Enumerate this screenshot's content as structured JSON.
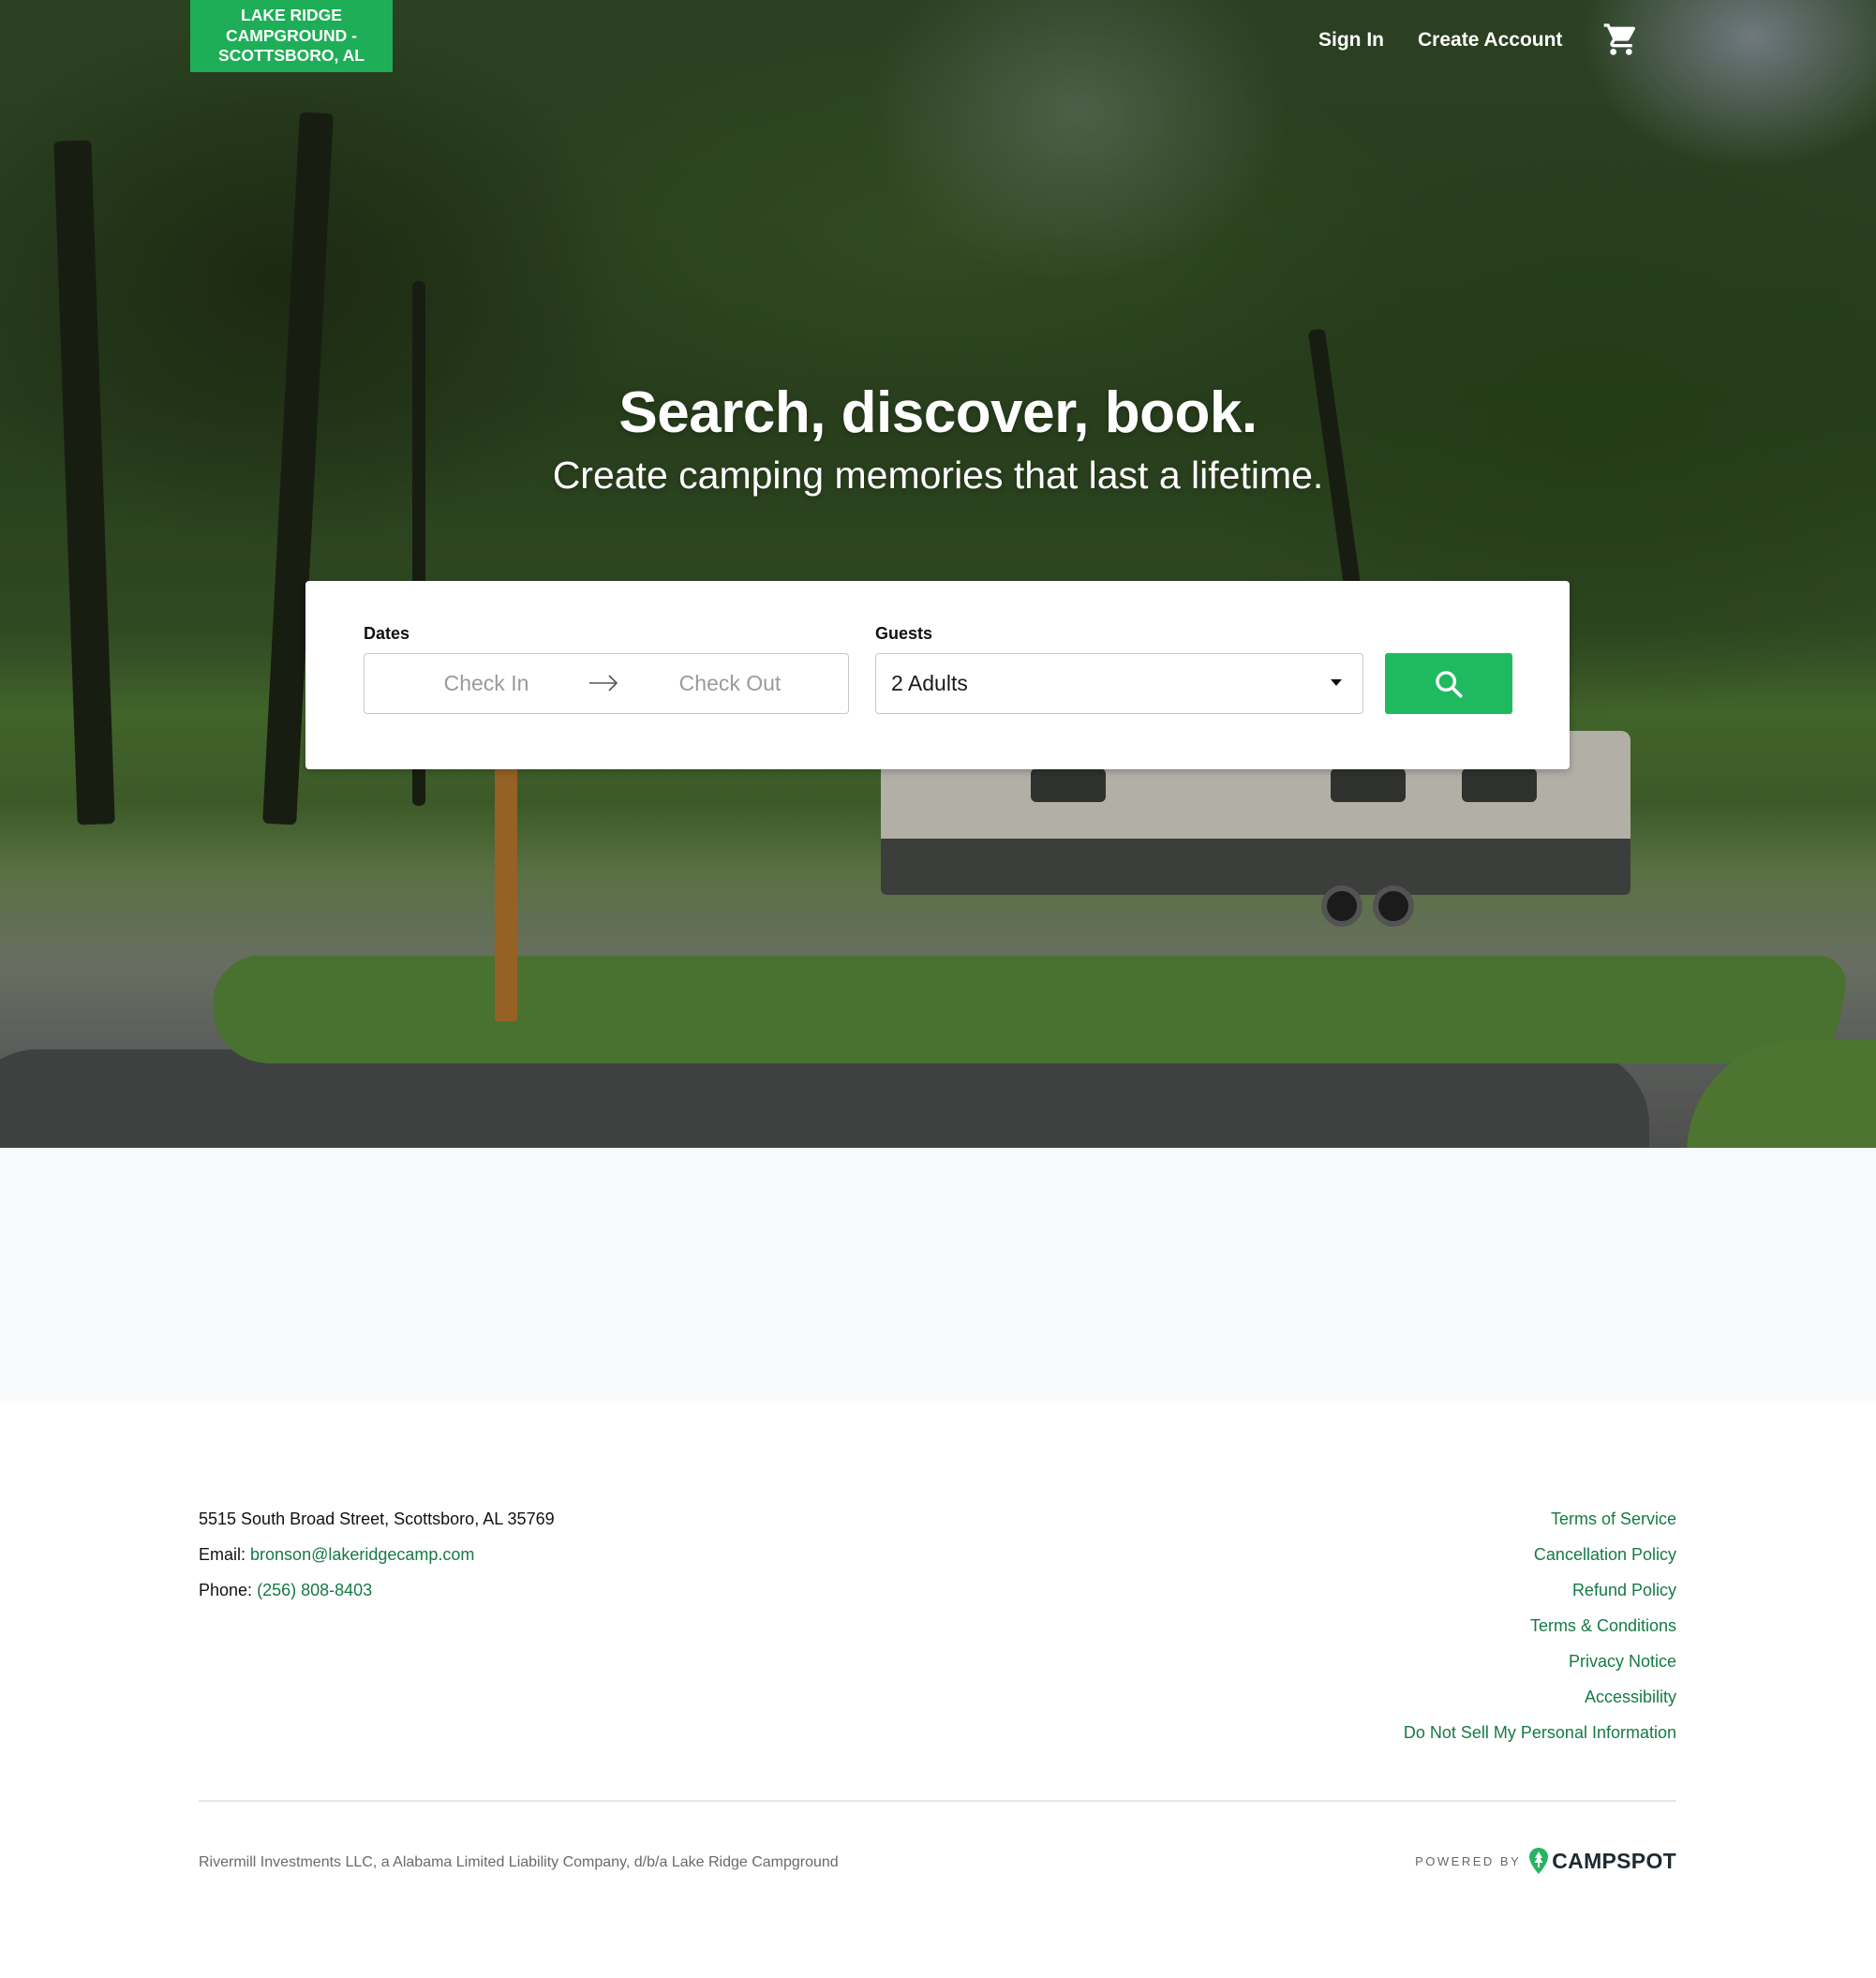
{
  "header": {
    "logo_text": "Lake Ridge Campground - Scottsboro, AL",
    "nav": {
      "sign_in": "Sign In",
      "create_account": "Create Account"
    },
    "cart_icon": "shopping-cart-icon"
  },
  "hero": {
    "title": "Search, discover, book.",
    "subtitle": "Create camping memories that last a lifetime."
  },
  "search": {
    "dates_label": "Dates",
    "check_in_placeholder": "Check In",
    "check_out_placeholder": "Check Out",
    "arrow_icon": "arrow-right-icon",
    "guests_label": "Guests",
    "guests_value": "2 Adults",
    "search_icon": "search-icon"
  },
  "footer": {
    "address": "5515 South Broad Street, Scottsboro, AL 35769",
    "email_label": "Email:",
    "email": "bronson@lakeridgecamp.com",
    "phone_label": "Phone:",
    "phone": "(256) 808-8403",
    "links": [
      "Terms of Service",
      "Cancellation Policy",
      "Refund Policy",
      "Terms & Conditions",
      "Privacy Notice",
      "Accessibility",
      "Do Not Sell My Personal Information"
    ],
    "legal": "Rivermill Investments LLC, a Alabama Limited Liability Company, d/b/a Lake Ridge Campground",
    "powered_by": "POWERED BY",
    "brand": "CAMPSPOT"
  },
  "colors": {
    "brand_green": "#1eae57",
    "button_green": "#1fba60",
    "link_green": "#157a45",
    "gray_band": "#f9fafb"
  }
}
